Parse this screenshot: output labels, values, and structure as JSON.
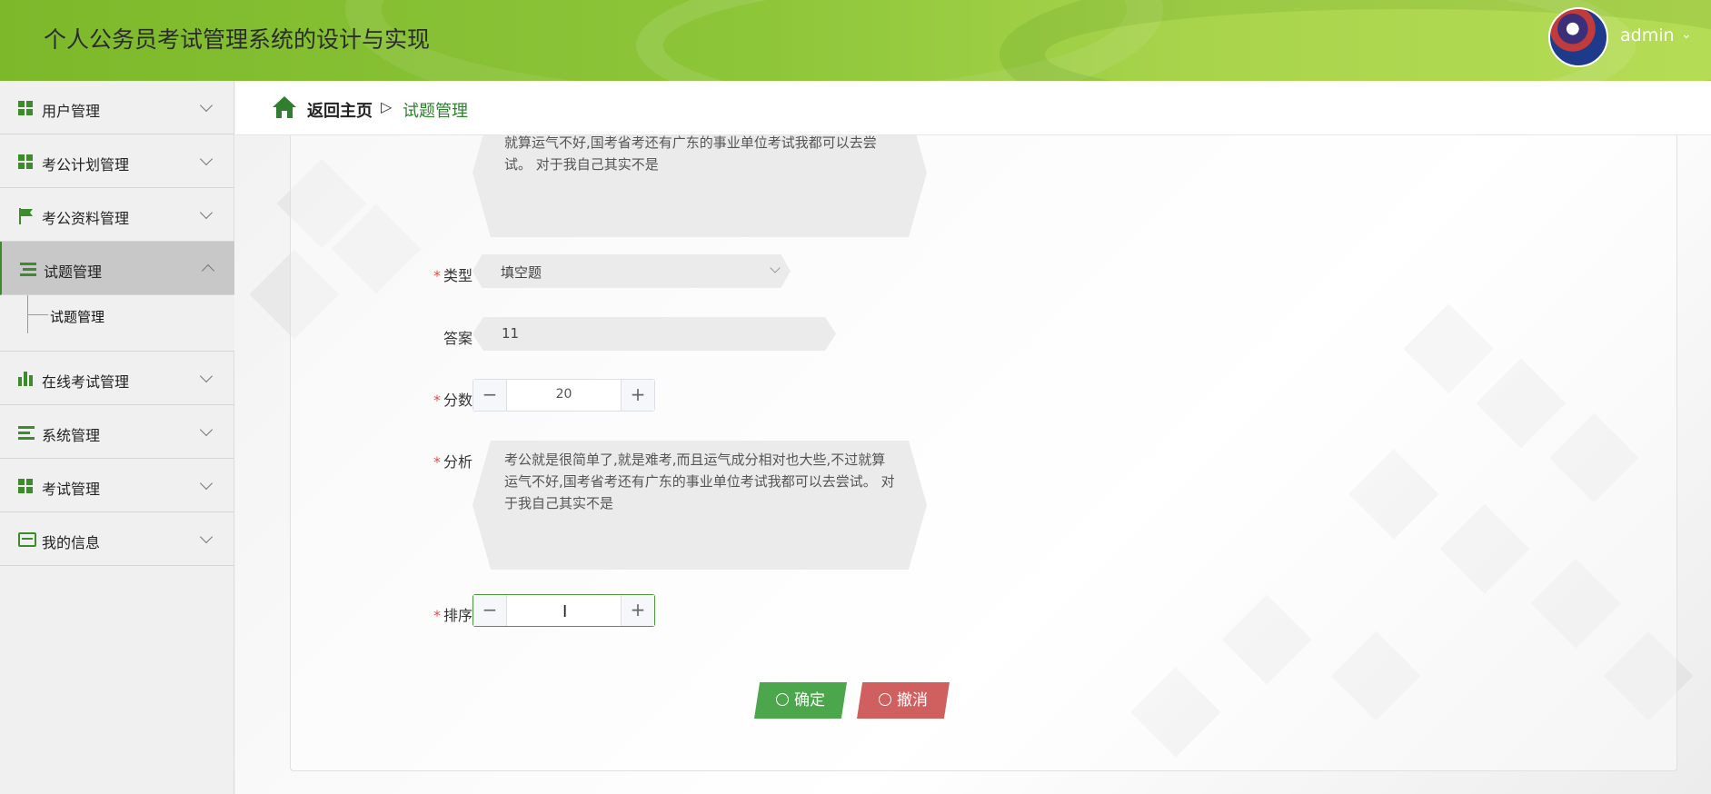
{
  "header": {
    "title": "个人公务员考试管理系统的设计与实现",
    "user": "admin",
    "user_chevron": "⌄"
  },
  "sidebar": {
    "items": [
      {
        "label": "用户管理",
        "icon": "grid-icon"
      },
      {
        "label": "考公计划管理",
        "icon": "grid-icon"
      },
      {
        "label": "考公资料管理",
        "icon": "flag-icon"
      },
      {
        "label": "试题管理",
        "icon": "list-icon",
        "active": true
      },
      {
        "label": "在线考试管理",
        "icon": "bar-chart-icon"
      },
      {
        "label": "系统管理",
        "icon": "list-icon"
      },
      {
        "label": "考试管理",
        "icon": "grid-icon"
      },
      {
        "label": "我的信息",
        "icon": "card-icon"
      }
    ],
    "submenu": {
      "label": "试题管理"
    }
  },
  "breadcrumb": {
    "home": "返回主页",
    "separator": "▷",
    "current": "试题管理"
  },
  "form": {
    "top_text": "就算运气不好,国考省考还有广东的事业单位考试我都可以去尝试。 对于我自己其实不是",
    "type": {
      "label": "类型",
      "value": "填空题"
    },
    "answer": {
      "label": "答案",
      "value": "11"
    },
    "score": {
      "label": "分数",
      "value": "20",
      "minus": "−",
      "plus": "+"
    },
    "analysis": {
      "label": "分析",
      "value": "考公就是很简单了,就是难考,而且运气成分相对也大些,不过就算运气不好,国考省考还有广东的事业单位考试我都可以去尝试。 对于我自己其实不是"
    },
    "sort": {
      "label": "排序",
      "value": "",
      "minus": "−",
      "plus": "+"
    },
    "required_mark": "*",
    "confirm_label": "确定",
    "cancel_label": "撤消"
  },
  "colors": {
    "accent": "#4ca64c",
    "header": "#8ec63a",
    "danger": "#d06060"
  }
}
